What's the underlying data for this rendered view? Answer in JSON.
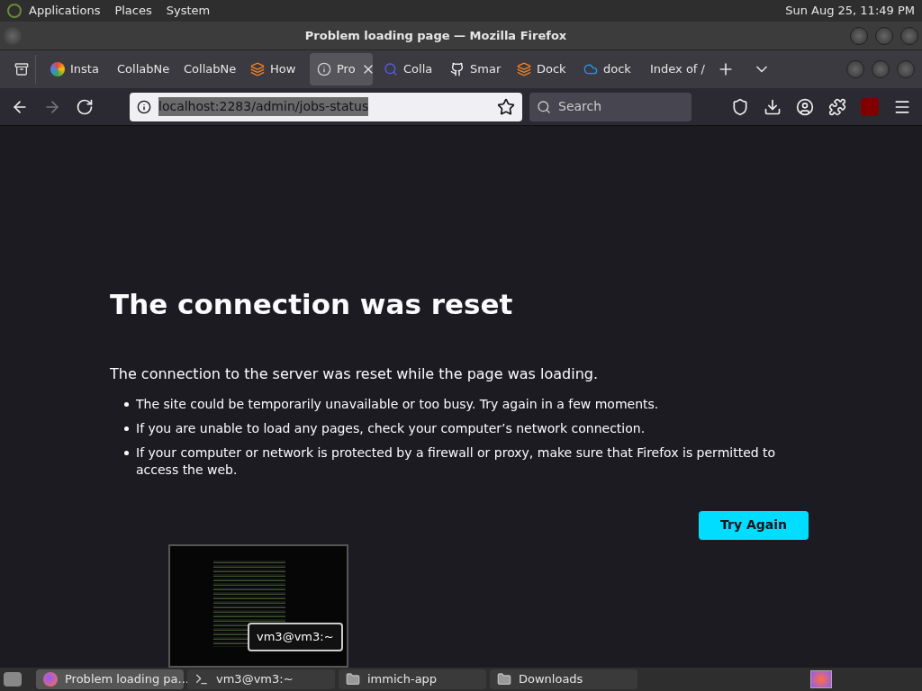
{
  "top_panel": {
    "menus": [
      "Applications",
      "Places",
      "System"
    ],
    "clock": "Sun Aug 25, 11:49 PM"
  },
  "window": {
    "title": "Problem loading page — Mozilla Firefox"
  },
  "tabs": [
    {
      "label": "Insta",
      "kind": "colorwheel",
      "selected": false
    },
    {
      "label": "CollabNe",
      "kind": "plain",
      "selected": false
    },
    {
      "label": "CollabNe",
      "kind": "plain",
      "selected": false
    },
    {
      "label": "How",
      "kind": "stack",
      "selected": false
    },
    {
      "label": "Pro",
      "kind": "info",
      "selected": true
    },
    {
      "label": "Colla",
      "kind": "search",
      "selected": false
    },
    {
      "label": "Smar",
      "kind": "github",
      "selected": false
    },
    {
      "label": "Dock",
      "kind": "stack",
      "selected": false
    },
    {
      "label": "dock",
      "kind": "cloud",
      "selected": false
    },
    {
      "label": "Index of /",
      "kind": "plain",
      "selected": false
    }
  ],
  "address_bar": {
    "url": "localhost:2283/admin/jobs-status"
  },
  "search": {
    "placeholder": "Search"
  },
  "error_page": {
    "title": "The connection was reset",
    "message": "The connection to the server was reset while the page was loading.",
    "bullets": [
      "The site could be temporarily unavailable or too busy. Try again in a few moments.",
      "If you are unable to load any pages, check your computer’s network connection.",
      "If your computer or network is protected by a firewall or proxy, make sure that Firefox is permitted to access the web."
    ],
    "button": "Try Again"
  },
  "window_preview": {
    "tooltip": "vm3@vm3:~"
  },
  "taskbar": [
    {
      "label": "Problem loading pa...",
      "kind": "firefox",
      "selected": true
    },
    {
      "label": "vm3@vm3:~",
      "kind": "terminal",
      "selected": false
    },
    {
      "label": "immich-app",
      "kind": "folder",
      "selected": false
    },
    {
      "label": "Downloads",
      "kind": "folder",
      "selected": false
    }
  ]
}
